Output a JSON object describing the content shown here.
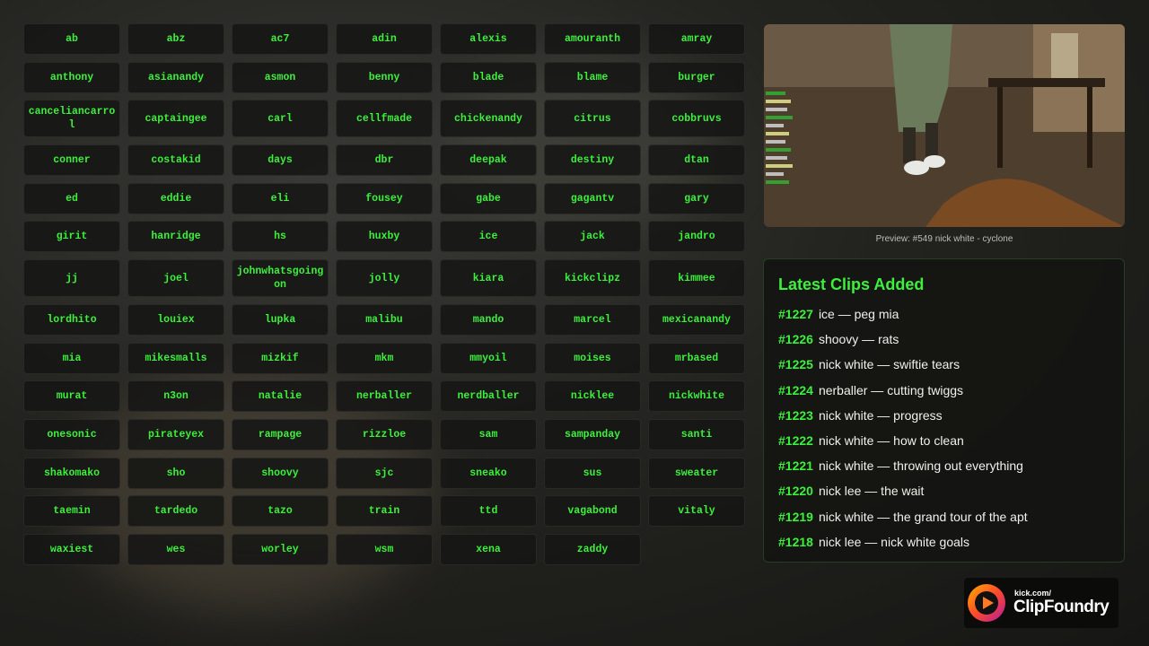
{
  "streamers": [
    "ab",
    "abz",
    "ac7",
    "adin",
    "alexis",
    "amouranth",
    "amray",
    "anthony",
    "asianandy",
    "asmon",
    "benny",
    "blade",
    "blame",
    "burger",
    "canceliancarrol",
    "captaingee",
    "carl",
    "cellfmade",
    "chickenandy",
    "citrus",
    "cobbruvs",
    "conner",
    "costakid",
    "days",
    "dbr",
    "deepak",
    "destiny",
    "dtan",
    "ed",
    "eddie",
    "eli",
    "fousey",
    "gabe",
    "gagantv",
    "gary",
    "girit",
    "hanridge",
    "hs",
    "huxby",
    "ice",
    "jack",
    "jandro",
    "jj",
    "joel",
    "johnwhatsgoingon",
    "jolly",
    "kiara",
    "kickclipz",
    "kimmee",
    "lordhito",
    "louiex",
    "lupka",
    "malibu",
    "mando",
    "marcel",
    "mexicanandy",
    "mia",
    "mikesmalls",
    "mizkif",
    "mkm",
    "mmyoil",
    "moises",
    "mrbased",
    "murat",
    "n3on",
    "natalie",
    "nerballer",
    "nerdballer",
    "nicklee",
    "nickwhite",
    "onesonic",
    "pirateyex",
    "rampage",
    "rizzloe",
    "sam",
    "sampanday",
    "santi",
    "shakomako",
    "sho",
    "shoovy",
    "sjc",
    "sneako",
    "sus",
    "sweater",
    "taemin",
    "tardedo",
    "tazo",
    "train",
    "ttd",
    "vagabond",
    "vitaly",
    "waxiest",
    "wes",
    "worley",
    "wsm",
    "xena",
    "zaddy"
  ],
  "preview": {
    "caption": "Preview: #549 nick white - cyclone"
  },
  "clips": {
    "title": "Latest Clips Added",
    "items": [
      {
        "num": "#1227",
        "text": "ice — peg mia"
      },
      {
        "num": "#1226",
        "text": "shoovy — rats"
      },
      {
        "num": "#1225",
        "text": "nick white — swiftie tears"
      },
      {
        "num": "#1224",
        "text": "nerballer — cutting twiggs"
      },
      {
        "num": "#1223",
        "text": "nick white — progress"
      },
      {
        "num": "#1222",
        "text": "nick white — how to clean"
      },
      {
        "num": "#1221",
        "text": "nick white — throwing out everything"
      },
      {
        "num": "#1220",
        "text": "nick lee — the wait"
      },
      {
        "num": "#1219",
        "text": "nick white — the grand tour of the apt"
      },
      {
        "num": "#1218",
        "text": "nick lee — nick white goals"
      }
    ]
  },
  "logo": {
    "small": "kick.com/",
    "big": "ClipFoundry"
  },
  "colors": {
    "accent": "#3cf03c",
    "panel": "#161614"
  }
}
